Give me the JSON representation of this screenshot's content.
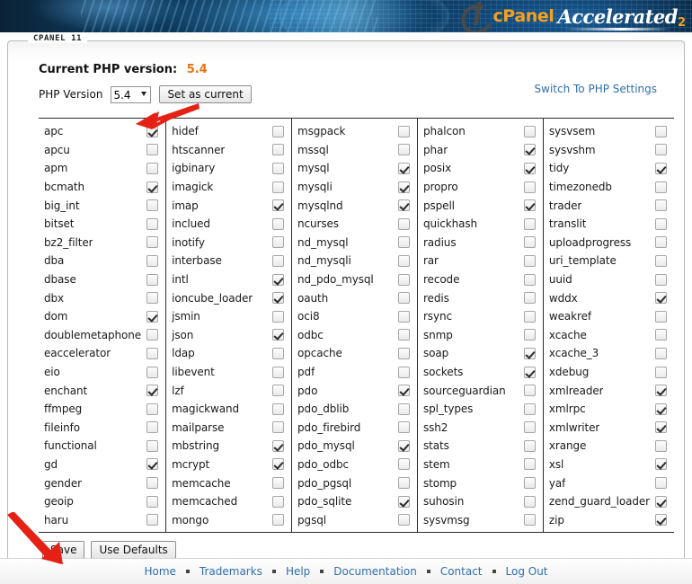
{
  "banner": {
    "logo_cpanel": "cPanel",
    "logo_accelerated": "Accelerated",
    "logo_superscript": "2"
  },
  "panel": {
    "legend": "CPANEL 11"
  },
  "php": {
    "current_version_label": "Current PHP version:",
    "current_version_value": "5.4",
    "version_field_label": "PHP Version",
    "selected_version": "5.4",
    "version_options": [
      "5.4"
    ],
    "set_as_current_label": "Set as current",
    "switch_link_label": "Switch To PHP Settings"
  },
  "actions": {
    "save_label": "Save",
    "use_defaults_label": "Use Defaults"
  },
  "footer": {
    "links": [
      "Home",
      "Trademarks",
      "Help",
      "Documentation",
      "Contact",
      "Log Out"
    ]
  },
  "colors": {
    "accent_orange": "#e8720c",
    "link_blue": "#2f6fae",
    "arrow_red": "#e52015"
  },
  "extensions": {
    "columns": [
      [
        {
          "name": "apc",
          "checked": true
        },
        {
          "name": "apcu",
          "checked": false
        },
        {
          "name": "apm",
          "checked": false
        },
        {
          "name": "bcmath",
          "checked": true
        },
        {
          "name": "big_int",
          "checked": false
        },
        {
          "name": "bitset",
          "checked": false
        },
        {
          "name": "bz2_filter",
          "checked": false
        },
        {
          "name": "dba",
          "checked": false
        },
        {
          "name": "dbase",
          "checked": false
        },
        {
          "name": "dbx",
          "checked": false
        },
        {
          "name": "dom",
          "checked": true
        },
        {
          "name": "doublemetaphone",
          "checked": false
        },
        {
          "name": "eaccelerator",
          "checked": false
        },
        {
          "name": "eio",
          "checked": false
        },
        {
          "name": "enchant",
          "checked": true
        },
        {
          "name": "ffmpeg",
          "checked": false
        },
        {
          "name": "fileinfo",
          "checked": false
        },
        {
          "name": "functional",
          "checked": false
        },
        {
          "name": "gd",
          "checked": true
        },
        {
          "name": "gender",
          "checked": false
        },
        {
          "name": "geoip",
          "checked": false
        },
        {
          "name": "haru",
          "checked": false
        }
      ],
      [
        {
          "name": "hidef",
          "checked": false
        },
        {
          "name": "htscanner",
          "checked": false
        },
        {
          "name": "igbinary",
          "checked": false
        },
        {
          "name": "imagick",
          "checked": false
        },
        {
          "name": "imap",
          "checked": true
        },
        {
          "name": "inclued",
          "checked": false
        },
        {
          "name": "inotify",
          "checked": false
        },
        {
          "name": "interbase",
          "checked": false
        },
        {
          "name": "intl",
          "checked": true
        },
        {
          "name": "ioncube_loader",
          "checked": true
        },
        {
          "name": "jsmin",
          "checked": false
        },
        {
          "name": "json",
          "checked": true
        },
        {
          "name": "ldap",
          "checked": false
        },
        {
          "name": "libevent",
          "checked": false
        },
        {
          "name": "lzf",
          "checked": false
        },
        {
          "name": "magickwand",
          "checked": false
        },
        {
          "name": "mailparse",
          "checked": false
        },
        {
          "name": "mbstring",
          "checked": true
        },
        {
          "name": "mcrypt",
          "checked": true
        },
        {
          "name": "memcache",
          "checked": false
        },
        {
          "name": "memcached",
          "checked": false
        },
        {
          "name": "mongo",
          "checked": false
        }
      ],
      [
        {
          "name": "msgpack",
          "checked": false
        },
        {
          "name": "mssql",
          "checked": false
        },
        {
          "name": "mysql",
          "checked": true
        },
        {
          "name": "mysqli",
          "checked": true
        },
        {
          "name": "mysqlnd",
          "checked": true
        },
        {
          "name": "ncurses",
          "checked": false
        },
        {
          "name": "nd_mysql",
          "checked": false
        },
        {
          "name": "nd_mysqli",
          "checked": false
        },
        {
          "name": "nd_pdo_mysql",
          "checked": false
        },
        {
          "name": "oauth",
          "checked": false
        },
        {
          "name": "oci8",
          "checked": false
        },
        {
          "name": "odbc",
          "checked": false
        },
        {
          "name": "opcache",
          "checked": false
        },
        {
          "name": "pdf",
          "checked": false
        },
        {
          "name": "pdo",
          "checked": true
        },
        {
          "name": "pdo_dblib",
          "checked": false
        },
        {
          "name": "pdo_firebird",
          "checked": false
        },
        {
          "name": "pdo_mysql",
          "checked": true
        },
        {
          "name": "pdo_odbc",
          "checked": false
        },
        {
          "name": "pdo_pgsql",
          "checked": false
        },
        {
          "name": "pdo_sqlite",
          "checked": true
        },
        {
          "name": "pgsql",
          "checked": false
        }
      ],
      [
        {
          "name": "phalcon",
          "checked": false
        },
        {
          "name": "phar",
          "checked": true
        },
        {
          "name": "posix",
          "checked": true
        },
        {
          "name": "propro",
          "checked": false
        },
        {
          "name": "pspell",
          "checked": true
        },
        {
          "name": "quickhash",
          "checked": false
        },
        {
          "name": "radius",
          "checked": false
        },
        {
          "name": "rar",
          "checked": false
        },
        {
          "name": "recode",
          "checked": false
        },
        {
          "name": "redis",
          "checked": false
        },
        {
          "name": "rsync",
          "checked": false
        },
        {
          "name": "snmp",
          "checked": false
        },
        {
          "name": "soap",
          "checked": true
        },
        {
          "name": "sockets",
          "checked": true
        },
        {
          "name": "sourceguardian",
          "checked": false
        },
        {
          "name": "spl_types",
          "checked": false
        },
        {
          "name": "ssh2",
          "checked": false
        },
        {
          "name": "stats",
          "checked": false
        },
        {
          "name": "stem",
          "checked": false
        },
        {
          "name": "stomp",
          "checked": false
        },
        {
          "name": "suhosin",
          "checked": false
        },
        {
          "name": "sysvmsg",
          "checked": false
        }
      ],
      [
        {
          "name": "sysvsem",
          "checked": false
        },
        {
          "name": "sysvshm",
          "checked": false
        },
        {
          "name": "tidy",
          "checked": true
        },
        {
          "name": "timezonedb",
          "checked": false
        },
        {
          "name": "trader",
          "checked": false
        },
        {
          "name": "translit",
          "checked": false
        },
        {
          "name": "uploadprogress",
          "checked": false
        },
        {
          "name": "uri_template",
          "checked": false
        },
        {
          "name": "uuid",
          "checked": false
        },
        {
          "name": "wddx",
          "checked": true
        },
        {
          "name": "weakref",
          "checked": false
        },
        {
          "name": "xcache",
          "checked": false
        },
        {
          "name": "xcache_3",
          "checked": false
        },
        {
          "name": "xdebug",
          "checked": false
        },
        {
          "name": "xmlreader",
          "checked": true
        },
        {
          "name": "xmlrpc",
          "checked": true
        },
        {
          "name": "xmlwriter",
          "checked": true
        },
        {
          "name": "xrange",
          "checked": false
        },
        {
          "name": "xsl",
          "checked": true
        },
        {
          "name": "yaf",
          "checked": false
        },
        {
          "name": "zend_guard_loader",
          "checked": true
        },
        {
          "name": "zip",
          "checked": true
        }
      ]
    ]
  }
}
